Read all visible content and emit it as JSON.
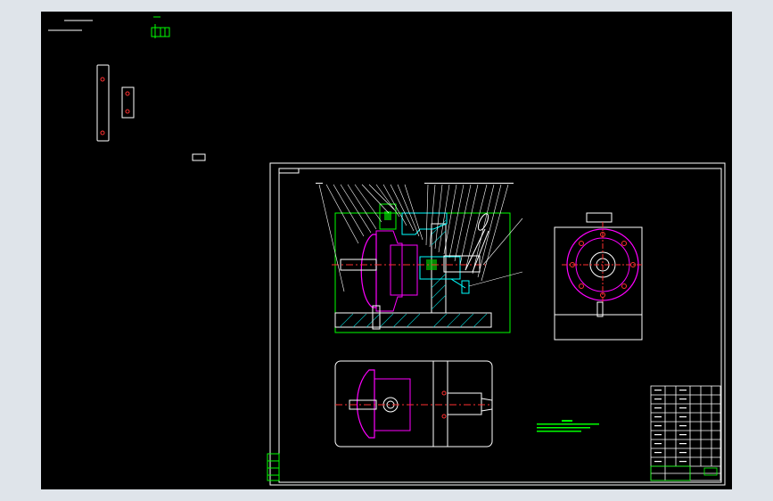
{
  "viewport": {
    "background": "#000000",
    "frame": "#dfe4ea"
  },
  "colors": {
    "outline": "#ffffff",
    "section": "#00ffff",
    "hatch": "#00e0e0",
    "feature": "#ff00ff",
    "dimension": "#00ff00",
    "centerline": "#ff3030",
    "leader": "#ffffff"
  },
  "drawing": {
    "title_block_rows": 11,
    "parts_count": 27,
    "views": [
      "front-section",
      "side-view",
      "top-view"
    ]
  }
}
